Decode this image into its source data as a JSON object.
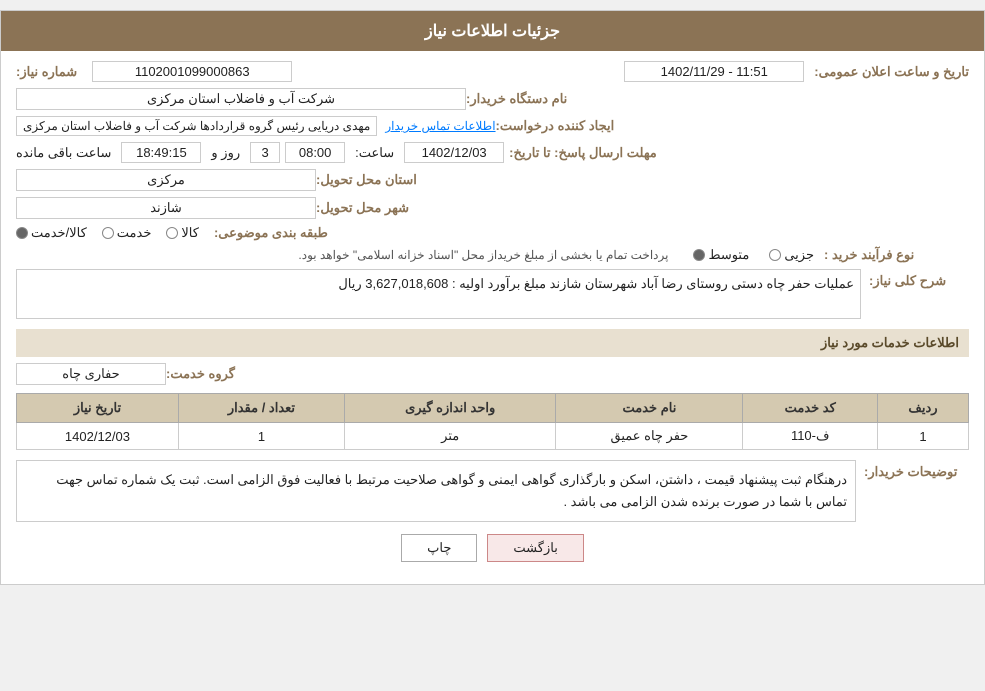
{
  "header": {
    "title": "جزئیات اطلاعات نیاز"
  },
  "need_number_label": "شماره نیاز:",
  "need_number_value": "1102001099000863",
  "requester_org_label": "نام دستگاه خریدار:",
  "requester_org_value": "شرکت آب و فاضلاب استان مرکزی",
  "creator_label": "ایجاد کننده درخواست:",
  "creator_value": "مهدی دریایی رئیس گروه قراردادها شرکت آب و فاضلاب استان مرکزی",
  "contact_info_link": "اطلاعات تماس خریدار",
  "deadline_label": "مهلت ارسال پاسخ: تا تاریخ:",
  "deadline_date": "1402/12/03",
  "deadline_time_label": "ساعت:",
  "deadline_time_value": "08:00",
  "remaining_days_label": "روز و",
  "remaining_days_value": "3",
  "remaining_time_label": "ساعت باقی مانده",
  "remaining_time_value": "18:49:15",
  "announce_date_label": "تاریخ و ساعت اعلان عمومی:",
  "announce_date_value": "1402/11/29 - 11:51",
  "delivery_province_label": "استان محل تحویل:",
  "delivery_province_value": "مرکزی",
  "delivery_city_label": "شهر محل تحویل:",
  "delivery_city_value": "شازند",
  "subject_label": "طبقه بندی موضوعی:",
  "subject_options": [
    {
      "label": "کالا",
      "selected": false
    },
    {
      "label": "خدمت",
      "selected": false
    },
    {
      "label": "کالا/خدمت",
      "selected": true
    }
  ],
  "process_label": "نوع فرآیند خرید :",
  "process_options": [
    {
      "label": "جزیی",
      "selected": false
    },
    {
      "label": "متوسط",
      "selected": true
    }
  ],
  "process_note": "پرداخت تمام یا بخشی از مبلغ خریداز محل \"اسناد خزانه اسلامی\" خواهد بود.",
  "description_label": "شرح کلی نیاز:",
  "description_value": "عملیات حفر چاه دستی روستای رضا آباد  شهرستان  شازند  مبلغ برآورد اولیه :       3,627,018,608 ریال",
  "services_header": "اطلاعات خدمات مورد نیاز",
  "service_group_label": "گروه خدمت:",
  "service_group_value": "حفاری چاه",
  "table": {
    "columns": [
      "ردیف",
      "کد خدمت",
      "نام خدمت",
      "واحد اندازه گیری",
      "تعداد / مقدار",
      "تاریخ نیاز"
    ],
    "rows": [
      {
        "row_num": "1",
        "code": "ف-110",
        "name": "حفر چاه عمیق",
        "unit": "متر",
        "quantity": "1",
        "date": "1402/12/03"
      }
    ]
  },
  "buyer_notes_label": "توضیحات خریدار:",
  "buyer_notes_text": "درهنگام ثبت پیشنهاد قیمت ، داشتن، اسکن و بارگذاری گواهی ایمنی و گواهی صلاحیت مرتبط با فعالیت فوق الزامی است. ثبت یک شماره تماس جهت تماس با شما در صورت برنده شدن الزامی می باشد .",
  "buttons": {
    "print": "چاپ",
    "back": "بازگشت"
  }
}
